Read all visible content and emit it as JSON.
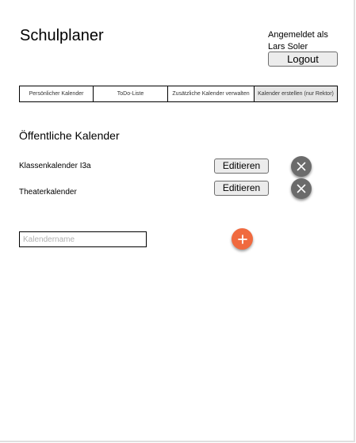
{
  "header": {
    "app_title": "Schulplaner",
    "logged_in_label": "Angemeldet als",
    "user_name": "Lars Soler",
    "logout_label": "Logout"
  },
  "tabs": [
    {
      "label": "Persönlicher Kalender",
      "active": false
    },
    {
      "label": "ToDo-Liste",
      "active": false
    },
    {
      "label": "Zusätzliche Kalender verwalten",
      "active": false
    },
    {
      "label": "Kalender erstellen (nur Rektor)",
      "active": true
    }
  ],
  "main": {
    "heading": "Öffentliche Kalender",
    "calendars": [
      {
        "name": "Klassenkalender I3a",
        "edit_label": "Editieren",
        "delete_icon": "close-icon"
      },
      {
        "name": "Theaterkalender",
        "edit_label": "Editieren",
        "delete_icon": "close-icon"
      }
    ],
    "new_calendar": {
      "value": "",
      "placeholder": "Kalendername",
      "add_icon": "plus-icon"
    }
  },
  "colors": {
    "active_tab_bg": "#e6e6e6",
    "delete_button": "#6b6b6b",
    "add_button": "#f06a3f",
    "button_bg": "#ececec"
  }
}
